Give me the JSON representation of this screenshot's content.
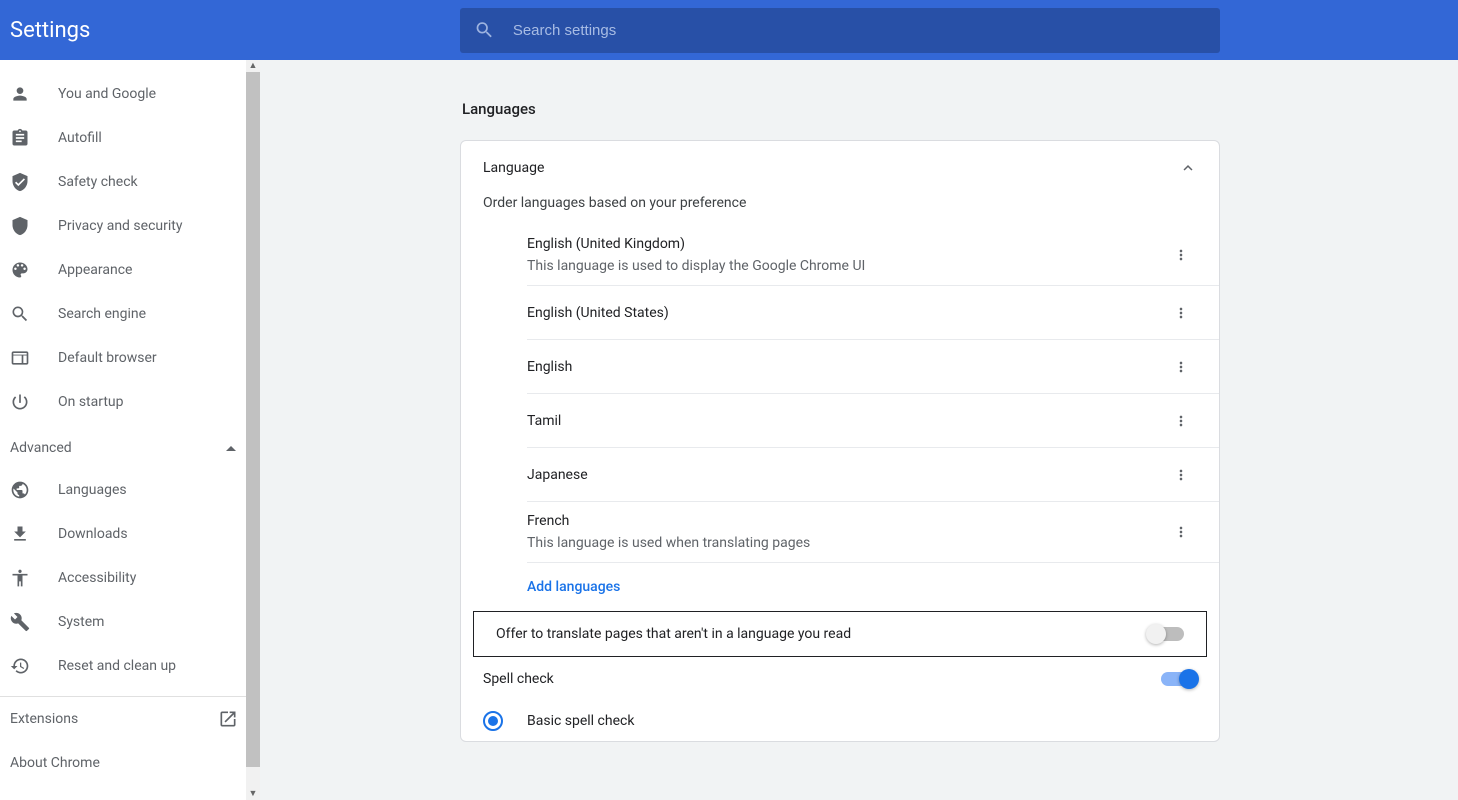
{
  "header": {
    "title": "Settings"
  },
  "search": {
    "placeholder": "Search settings"
  },
  "sidebar": {
    "main_items": [
      {
        "label": "You and Google"
      },
      {
        "label": "Autofill"
      },
      {
        "label": "Safety check"
      },
      {
        "label": "Privacy and security"
      },
      {
        "label": "Appearance"
      },
      {
        "label": "Search engine"
      },
      {
        "label": "Default browser"
      },
      {
        "label": "On startup"
      }
    ],
    "advanced_label": "Advanced",
    "advanced_items": [
      {
        "label": "Languages"
      },
      {
        "label": "Downloads"
      },
      {
        "label": "Accessibility"
      },
      {
        "label": "System"
      },
      {
        "label": "Reset and clean up"
      }
    ],
    "extensions_label": "Extensions",
    "about_label": "About Chrome"
  },
  "main": {
    "section_title": "Languages",
    "card_header": "Language",
    "order_text": "Order languages based on your preference",
    "languages": [
      {
        "name": "English (United Kingdom)",
        "desc": "This language is used to display the Google Chrome UI"
      },
      {
        "name": "English (United States)",
        "desc": ""
      },
      {
        "name": "English",
        "desc": ""
      },
      {
        "name": "Tamil",
        "desc": ""
      },
      {
        "name": "Japanese",
        "desc": ""
      },
      {
        "name": "French",
        "desc": "This language is used when translating pages"
      }
    ],
    "add_languages": "Add languages",
    "translate_toggle_label": "Offer to translate pages that aren't in a language you read",
    "spellcheck_label": "Spell check",
    "basic_spell": "Basic spell check"
  }
}
